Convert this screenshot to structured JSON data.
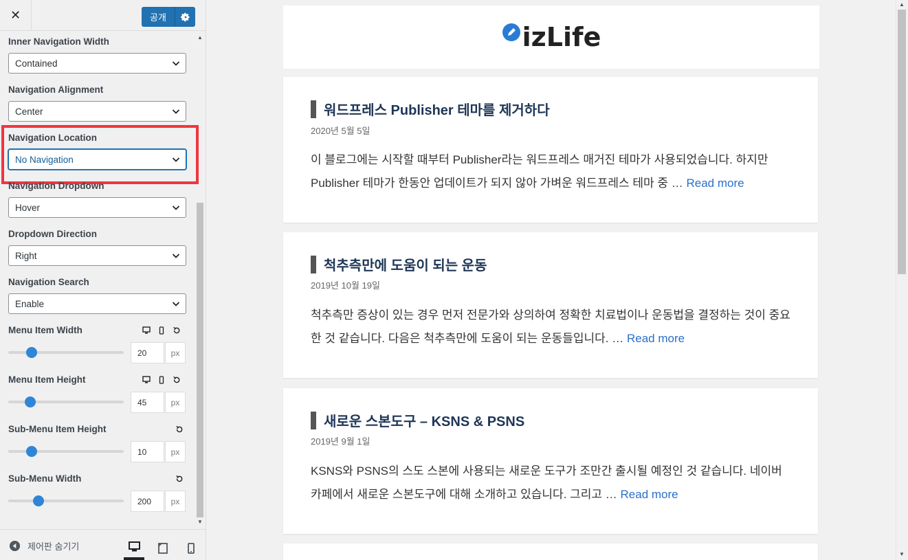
{
  "header": {
    "close_label": "✕",
    "publish_label": "공개"
  },
  "controls": {
    "inner_nav_width": {
      "label": "Inner Navigation Width",
      "value": "Contained"
    },
    "nav_alignment": {
      "label": "Navigation Alignment",
      "value": "Center"
    },
    "nav_location": {
      "label": "Navigation Location",
      "value": "No Navigation"
    },
    "nav_dropdown": {
      "label": "Navigation Dropdown",
      "value": "Hover"
    },
    "dropdown_direction": {
      "label": "Dropdown Direction",
      "value": "Right"
    },
    "nav_search": {
      "label": "Navigation Search",
      "value": "Enable"
    },
    "menu_item_width": {
      "label": "Menu Item Width",
      "value": "20",
      "unit": "px",
      "slider_fraction": 0.2
    },
    "menu_item_height": {
      "label": "Menu Item Height",
      "value": "45",
      "unit": "px",
      "slider_fraction": 0.19
    },
    "submenu_item_height": {
      "label": "Sub-Menu Item Height",
      "value": "10",
      "unit": "px",
      "slider_fraction": 0.2
    },
    "submenu_width": {
      "label": "Sub-Menu Width",
      "value": "200",
      "unit": "px",
      "slider_fraction": 0.26
    }
  },
  "footer": {
    "hide_controls_label": "제어판 숨기기",
    "active_device": "desktop"
  },
  "preview": {
    "site_logo": "izLife",
    "read_more_label": "Read more",
    "posts": [
      {
        "title": "워드프레스 Publisher 테마를 제거하다",
        "date": "2020년 5월 5일",
        "excerpt": "이 블로그에는 시작할 때부터 Publisher라는 워드프레스 매거진 테마가 사용되었습니다. 하지만 Publisher 테마가 한동안 업데이트가 되지 않아 가벼운 워드프레스 테마 중 …"
      },
      {
        "title": "척추측만에 도움이 되는 운동",
        "date": "2019년 10월 19일",
        "excerpt": "척추측만 증상이 있는 경우 먼저 전문가와 상의하여 정확한 치료법이나 운동법을 결정하는 것이 중요한 것 같습니다. 다음은 척추측만에 도움이 되는 운동들입니다. …"
      },
      {
        "title": "새로운 스본도구 – KSNS & PSNS",
        "date": "2019년 9월 1일",
        "excerpt": "KSNS와 PSNS의 스도 스본에 사용되는 새로운 도구가 조만간 출시될 예정인 것 같습니다. 네이버 카페에서 새로운 스본도구에 대해 소개하고 있습니다. 그리고 …"
      }
    ]
  },
  "colors": {
    "accent": "#2271b1",
    "highlight": "#f0353f",
    "slider_knob": "#2f86d6",
    "link": "#2a6fc9",
    "post_title": "#1e3656"
  }
}
